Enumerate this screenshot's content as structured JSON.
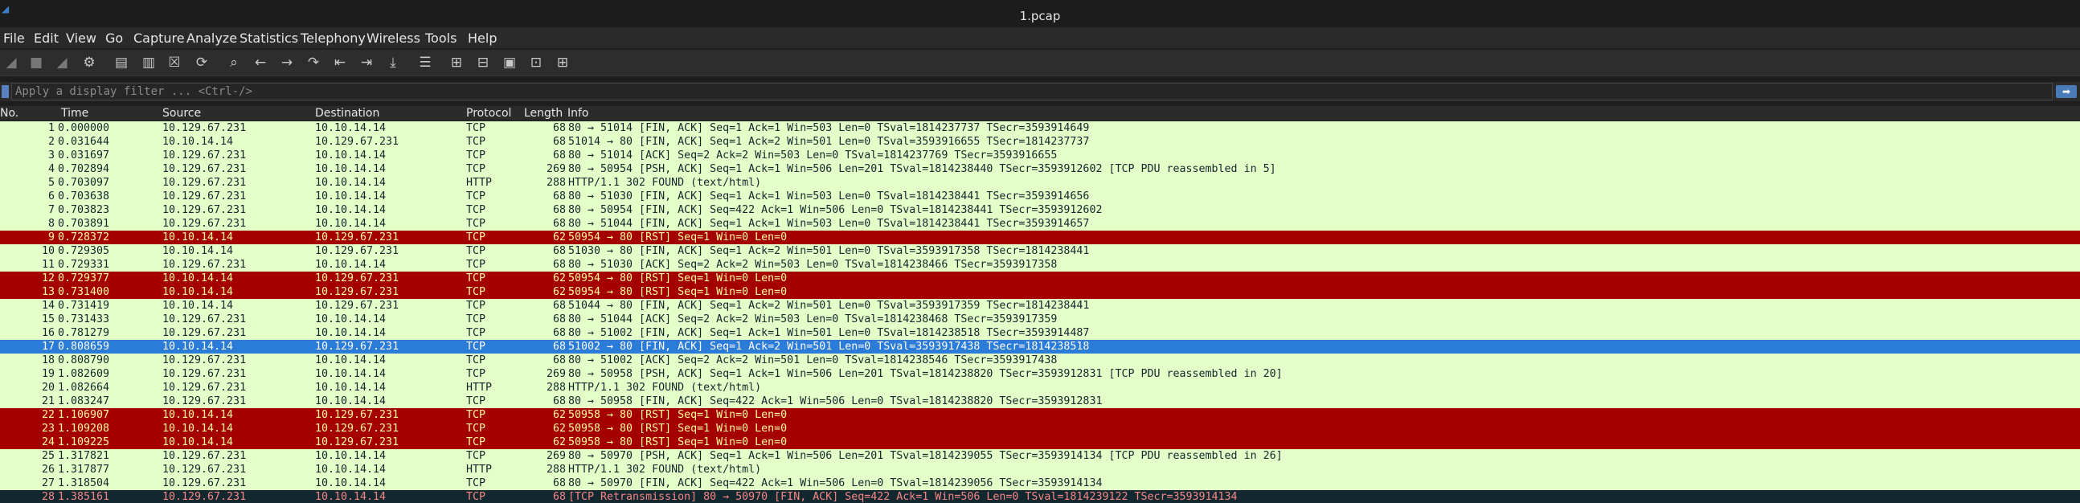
{
  "window": {
    "title": "1.pcap"
  },
  "menu": [
    "File",
    "Edit",
    "View",
    "Go",
    "Capture",
    "Analyze",
    "Statistics",
    "Telephony",
    "Wireless",
    "Tools",
    "Help"
  ],
  "toolbar": {
    "icons": [
      "start-capture-icon",
      "stop-capture-icon",
      "restart-capture-icon",
      "capture-options-icon",
      "open-file-icon",
      "save-file-icon",
      "close-file-icon",
      "reload-file-icon",
      "find-packet-icon",
      "go-back-icon",
      "go-forward-icon",
      "go-to-packet-icon",
      "first-packet-icon",
      "last-packet-icon",
      "autoscroll-icon",
      "colorize-icon",
      "zoom-in-icon",
      "zoom-out-icon",
      "normal-size-icon",
      "resize-columns-icon"
    ]
  },
  "filter": {
    "placeholder": "Apply a display filter ... <Ctrl-/>"
  },
  "columns": {
    "no": "No.",
    "time": "Time",
    "source": "Source",
    "destination": "Destination",
    "protocol": "Protocol",
    "length": "Length",
    "info": "Info"
  },
  "packets": [
    {
      "no": "1",
      "time": "0.000000",
      "src": "10.129.67.231",
      "dst": "10.10.14.14",
      "proto": "TCP",
      "len": "68",
      "info": "80 → 51014 [FIN, ACK] Seq=1 Ack=1 Win=503 Len=0 TSval=1814237737 TSecr=3593914649",
      "style": "tcp"
    },
    {
      "no": "2",
      "time": "0.031644",
      "src": "10.10.14.14",
      "dst": "10.129.67.231",
      "proto": "TCP",
      "len": "68",
      "info": "51014 → 80 [FIN, ACK] Seq=1 Ack=2 Win=501 Len=0 TSval=3593916655 TSecr=1814237737",
      "style": "tcp"
    },
    {
      "no": "3",
      "time": "0.031697",
      "src": "10.129.67.231",
      "dst": "10.10.14.14",
      "proto": "TCP",
      "len": "68",
      "info": "80 → 51014 [ACK] Seq=2 Ack=2 Win=503 Len=0 TSval=1814237769 TSecr=3593916655",
      "style": "tcp"
    },
    {
      "no": "4",
      "time": "0.702894",
      "src": "10.129.67.231",
      "dst": "10.10.14.14",
      "proto": "TCP",
      "len": "269",
      "info": "80 → 50954 [PSH, ACK] Seq=1 Ack=1 Win=506 Len=201 TSval=1814238440 TSecr=3593912602 [TCP PDU reassembled in 5]",
      "style": "tcp"
    },
    {
      "no": "5",
      "time": "0.703097",
      "src": "10.129.67.231",
      "dst": "10.10.14.14",
      "proto": "HTTP",
      "len": "288",
      "info": "HTTP/1.1 302 FOUND  (text/html)",
      "style": "http"
    },
    {
      "no": "6",
      "time": "0.703638",
      "src": "10.129.67.231",
      "dst": "10.10.14.14",
      "proto": "TCP",
      "len": "68",
      "info": "80 → 51030 [FIN, ACK] Seq=1 Ack=1 Win=503 Len=0 TSval=1814238441 TSecr=3593914656",
      "style": "tcp"
    },
    {
      "no": "7",
      "time": "0.703823",
      "src": "10.129.67.231",
      "dst": "10.10.14.14",
      "proto": "TCP",
      "len": "68",
      "info": "80 → 50954 [FIN, ACK] Seq=422 Ack=1 Win=506 Len=0 TSval=1814238441 TSecr=3593912602",
      "style": "tcp"
    },
    {
      "no": "8",
      "time": "0.703891",
      "src": "10.129.67.231",
      "dst": "10.10.14.14",
      "proto": "TCP",
      "len": "68",
      "info": "80 → 51044 [FIN, ACK] Seq=1 Ack=1 Win=503 Len=0 TSval=1814238441 TSecr=3593914657",
      "style": "tcp"
    },
    {
      "no": "9",
      "time": "0.728372",
      "src": "10.10.14.14",
      "dst": "10.129.67.231",
      "proto": "TCP",
      "len": "62",
      "info": "50954 → 80 [RST] Seq=1 Win=0 Len=0",
      "style": "rst"
    },
    {
      "no": "10",
      "time": "0.729305",
      "src": "10.10.14.14",
      "dst": "10.129.67.231",
      "proto": "TCP",
      "len": "68",
      "info": "51030 → 80 [FIN, ACK] Seq=1 Ack=2 Win=501 Len=0 TSval=3593917358 TSecr=1814238441",
      "style": "tcp"
    },
    {
      "no": "11",
      "time": "0.729331",
      "src": "10.129.67.231",
      "dst": "10.10.14.14",
      "proto": "TCP",
      "len": "68",
      "info": "80 → 51030 [ACK] Seq=2 Ack=2 Win=503 Len=0 TSval=1814238466 TSecr=3593917358",
      "style": "tcp"
    },
    {
      "no": "12",
      "time": "0.729377",
      "src": "10.10.14.14",
      "dst": "10.129.67.231",
      "proto": "TCP",
      "len": "62",
      "info": "50954 → 80 [RST] Seq=1 Win=0 Len=0",
      "style": "rst"
    },
    {
      "no": "13",
      "time": "0.731400",
      "src": "10.10.14.14",
      "dst": "10.129.67.231",
      "proto": "TCP",
      "len": "62",
      "info": "50954 → 80 [RST] Seq=1 Win=0 Len=0",
      "style": "rst"
    },
    {
      "no": "14",
      "time": "0.731419",
      "src": "10.10.14.14",
      "dst": "10.129.67.231",
      "proto": "TCP",
      "len": "68",
      "info": "51044 → 80 [FIN, ACK] Seq=1 Ack=2 Win=501 Len=0 TSval=3593917359 TSecr=1814238441",
      "style": "tcp"
    },
    {
      "no": "15",
      "time": "0.731433",
      "src": "10.129.67.231",
      "dst": "10.10.14.14",
      "proto": "TCP",
      "len": "68",
      "info": "80 → 51044 [ACK] Seq=2 Ack=2 Win=503 Len=0 TSval=1814238468 TSecr=3593917359",
      "style": "tcp"
    },
    {
      "no": "16",
      "time": "0.781279",
      "src": "10.129.67.231",
      "dst": "10.10.14.14",
      "proto": "TCP",
      "len": "68",
      "info": "80 → 51002 [FIN, ACK] Seq=1 Ack=1 Win=501 Len=0 TSval=1814238518 TSecr=3593914487",
      "style": "tcp"
    },
    {
      "no": "17",
      "time": "0.808659",
      "src": "10.10.14.14",
      "dst": "10.129.67.231",
      "proto": "TCP",
      "len": "68",
      "info": "51002 → 80 [FIN, ACK] Seq=1 Ack=2 Win=501 Len=0 TSval=3593917438 TSecr=1814238518",
      "style": "sel"
    },
    {
      "no": "18",
      "time": "0.808790",
      "src": "10.129.67.231",
      "dst": "10.10.14.14",
      "proto": "TCP",
      "len": "68",
      "info": "80 → 51002 [ACK] Seq=2 Ack=2 Win=501 Len=0 TSval=1814238546 TSecr=3593917438",
      "style": "tcp"
    },
    {
      "no": "19",
      "time": "1.082609",
      "src": "10.129.67.231",
      "dst": "10.10.14.14",
      "proto": "TCP",
      "len": "269",
      "info": "80 → 50958 [PSH, ACK] Seq=1 Ack=1 Win=506 Len=201 TSval=1814238820 TSecr=3593912831 [TCP PDU reassembled in 20]",
      "style": "tcp"
    },
    {
      "no": "20",
      "time": "1.082664",
      "src": "10.129.67.231",
      "dst": "10.10.14.14",
      "proto": "HTTP",
      "len": "288",
      "info": "HTTP/1.1 302 FOUND  (text/html)",
      "style": "http"
    },
    {
      "no": "21",
      "time": "1.083247",
      "src": "10.129.67.231",
      "dst": "10.10.14.14",
      "proto": "TCP",
      "len": "68",
      "info": "80 → 50958 [FIN, ACK] Seq=422 Ack=1 Win=506 Len=0 TSval=1814238820 TSecr=3593912831",
      "style": "tcp"
    },
    {
      "no": "22",
      "time": "1.106907",
      "src": "10.10.14.14",
      "dst": "10.129.67.231",
      "proto": "TCP",
      "len": "62",
      "info": "50958 → 80 [RST] Seq=1 Win=0 Len=0",
      "style": "rst"
    },
    {
      "no": "23",
      "time": "1.109208",
      "src": "10.10.14.14",
      "dst": "10.129.67.231",
      "proto": "TCP",
      "len": "62",
      "info": "50958 → 80 [RST] Seq=1 Win=0 Len=0",
      "style": "rst"
    },
    {
      "no": "24",
      "time": "1.109225",
      "src": "10.10.14.14",
      "dst": "10.129.67.231",
      "proto": "TCP",
      "len": "62",
      "info": "50958 → 80 [RST] Seq=1 Win=0 Len=0",
      "style": "rst"
    },
    {
      "no": "25",
      "time": "1.317821",
      "src": "10.129.67.231",
      "dst": "10.10.14.14",
      "proto": "TCP",
      "len": "269",
      "info": "80 → 50970 [PSH, ACK] Seq=1 Ack=1 Win=506 Len=201 TSval=1814239055 TSecr=3593914134 [TCP PDU reassembled in 26]",
      "style": "tcp"
    },
    {
      "no": "26",
      "time": "1.317877",
      "src": "10.129.67.231",
      "dst": "10.10.14.14",
      "proto": "HTTP",
      "len": "288",
      "info": "HTTP/1.1 302 FOUND  (text/html)",
      "style": "http"
    },
    {
      "no": "27",
      "time": "1.318504",
      "src": "10.129.67.231",
      "dst": "10.10.14.14",
      "proto": "TCP",
      "len": "68",
      "info": "80 → 50970 [FIN, ACK] Seq=422 Ack=1 Win=506 Len=0 TSval=1814239056 TSecr=3593914134",
      "style": "tcp"
    },
    {
      "no": "28",
      "time": "1.385161",
      "src": "10.129.67.231",
      "dst": "10.10.14.14",
      "proto": "TCP",
      "len": "68",
      "info": "[TCP Retransmission] 80 → 50970 [FIN, ACK] Seq=422 Ack=1 Win=506 Len=0 TSval=1814239122 TSecr=3593914134",
      "style": "bad"
    }
  ]
}
